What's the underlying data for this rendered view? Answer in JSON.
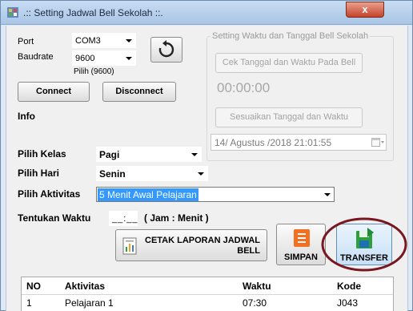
{
  "window": {
    "title": ".:: Setting Jadwal Bell Sekolah ::.",
    "close_label": "x"
  },
  "connection": {
    "port_label": "Port",
    "port_value": "COM3",
    "baudrate_label": "Baudrate",
    "baudrate_value": "9600",
    "baudrate_hint": "Pilih (9600)",
    "connect_label": "Connect",
    "disconnect_label": "Disconnect",
    "info_label": "Info"
  },
  "datetime_group": {
    "legend": "Setting Waktu dan Tanggal  Bell Sekolah",
    "check_button_label": "Cek Tanggal dan Waktu Pada Bell",
    "time_display": "00:00:00",
    "sync_button_label": "Sesuaikan Tanggal dan Waktu",
    "datetime_value": "14/  Agustus  /2018 21:01:55"
  },
  "form": {
    "kelas_label": "Pilih Kelas",
    "kelas_value": "Pagi",
    "hari_label": "Pilih Hari",
    "hari_value": "Senin",
    "aktivitas_label": "Pilih Aktivitas",
    "aktivitas_value": "5 Menit Awal Pelajaran",
    "waktu_label": "Tentukan Waktu",
    "waktu_value": "__:__",
    "waktu_hint": "( Jam : Menit )"
  },
  "actions": {
    "report_label_line1": "CETAK LAPORAN JADWAL",
    "report_label_line2": "BELL",
    "save_label": "SIMPAN",
    "transfer_label": "TRANSFER"
  },
  "table": {
    "columns": [
      "NO",
      "Aktivitas",
      "Waktu",
      "Kode"
    ],
    "rows": [
      [
        "1",
        "Pelajaran 1",
        "07:30",
        "J043"
      ]
    ]
  },
  "colors": {
    "selection": "#3399ff",
    "highlight_ring": "#7a1620",
    "save_icon": "#f37021",
    "transfer_icon": "#2e9f3f"
  }
}
